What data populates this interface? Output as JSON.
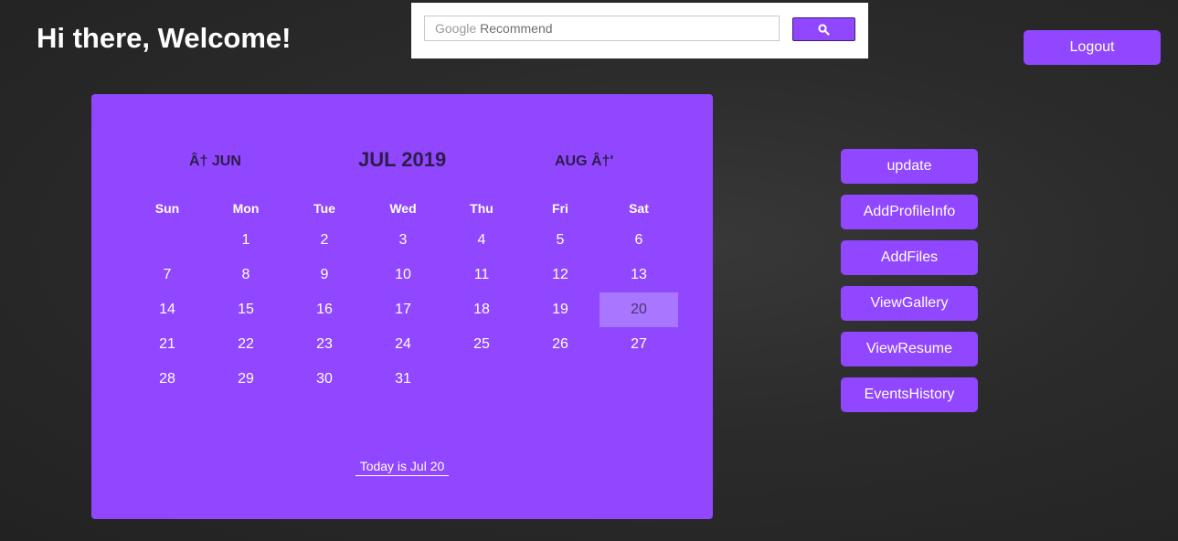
{
  "header": {
    "greeting": "Hi there, Welcome!",
    "logout_label": "Logout"
  },
  "search": {
    "brand": "Google",
    "placeholder": "Recommend",
    "button_icon": "search-icon"
  },
  "calendar": {
    "prev_label": "Â†   JUN",
    "month_label": "JUL 2019",
    "next_label": "AUG Â†'",
    "weekdays": [
      "Sun",
      "Mon",
      "Tue",
      "Wed",
      "Thu",
      "Fri",
      "Sat"
    ],
    "weeks": [
      [
        "",
        "1",
        "2",
        "3",
        "4",
        "5",
        "6"
      ],
      [
        "7",
        "8",
        "9",
        "10",
        "11",
        "12",
        "13"
      ],
      [
        "14",
        "15",
        "16",
        "17",
        "18",
        "19",
        "20"
      ],
      [
        "21",
        "22",
        "23",
        "24",
        "25",
        "26",
        "27"
      ],
      [
        "28",
        "29",
        "30",
        "31",
        "",
        "",
        ""
      ]
    ],
    "selected_day": "20",
    "today_label": "Today is Jul 20"
  },
  "actions": [
    "update",
    "AddProfileInfo",
    "AddFiles",
    "ViewGallery",
    "ViewResume",
    "EventsHistory"
  ],
  "colors": {
    "accent": "#9147ff",
    "selected_day": "#a876ff",
    "background": "#2b2b2b"
  }
}
